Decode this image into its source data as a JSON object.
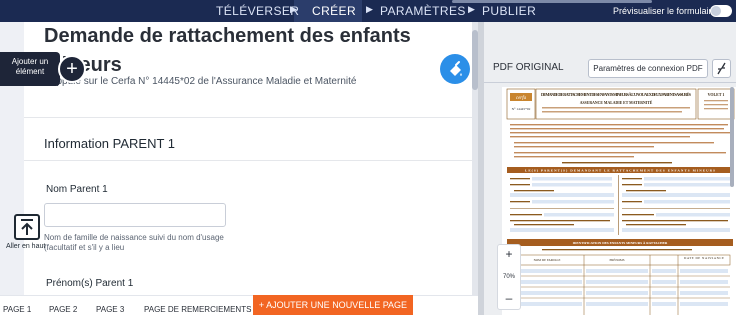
{
  "nav": {
    "tabs": [
      "TÉLÉVERSER",
      "CRÉER",
      "PARAMÈTRES",
      "PUBLIER"
    ],
    "active_tab": "CRÉER",
    "preview_label": "Prévisualiser le formulaire",
    "preview_enabled": false
  },
  "form": {
    "title": "Demande de rattachement des enfants mineurs",
    "subtitle": "s'appuie sur le Cerfa N° 14445*02 de l'Assurance Maladie et Maternité",
    "section_title": "Information PARENT 1",
    "fields": [
      {
        "label": "Nom Parent 1",
        "value": "",
        "help": "Nom de famille de naissance suivi du nom d'usage (facultatif et s'il y a lieu"
      },
      {
        "label": "Prénom(s) Parent 1"
      }
    ]
  },
  "add_element": {
    "label": "Ajouter un élément",
    "icon": "plus-icon"
  },
  "go_top": {
    "label": "Aller en haut",
    "icon": "arrow-up-icon"
  },
  "fab_icon": "paint-bucket-icon",
  "pages": [
    "PAGE 1",
    "PAGE 2",
    "PAGE 3",
    "PAGE DE REMERCIEMENTS"
  ],
  "add_page_label": "+ AJOUTER UNE NOUVELLE PAGE",
  "pdf": {
    "title": "PDF ORIGINAL",
    "connection_button": "Paramètres de connexion PDF",
    "collapse_icon": "collapse-icon",
    "zoom": "70%",
    "zoom_in": "+",
    "zoom_out": "–",
    "doc": {
      "logo": "cerfa",
      "number": "N° 14445*02",
      "heading": "DEMANDE DE RATTACHEMENT DES ENFANTS MINEURS À L'UN OU AUX DEUX PARENTS ASSURÉS",
      "sub": "ASSURANCE MALADIE ET MATERNITÉ",
      "volet": "VOLET 1",
      "band1": "LE(S) PARENT(S) DEMANDANT LE RATTACHEMENT DES ENFANTS MINEURS",
      "band2": "IDENTIFICATION DES ENFANTS MINEURS À RATTACHER",
      "col1": "NOM DE FAMILLE",
      "col2": "PRÉNOMS",
      "col3": "DATE DE NAISSANCE"
    }
  },
  "colors": {
    "nav_bg": "#1b2a52",
    "accent_orange": "#f26522",
    "fab_blue": "#2b8fe8",
    "pdf_brown": "#8b5a1e"
  }
}
